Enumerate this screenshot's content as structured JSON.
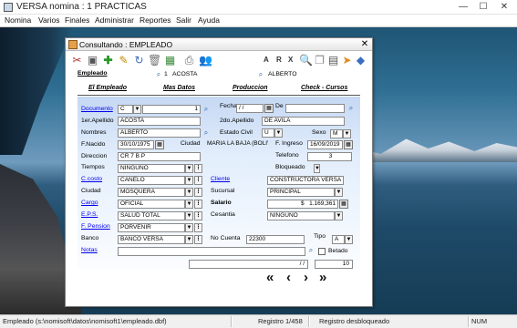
{
  "window": {
    "title": "VERSA nomina : 1 PRACTICAS",
    "minimize": "—",
    "maximize": "☐",
    "close": "✕"
  },
  "menu": [
    "Nomina",
    "Varios",
    "Finales",
    "Administrar",
    "Reportes",
    "Salir",
    "Ayuda"
  ],
  "dialog": {
    "title": "Consultando : EMPLEADO",
    "close": "✕",
    "toolbar_letters": [
      "A",
      "R",
      "X"
    ],
    "empleado_label": "Empleado",
    "empleado_code": "1",
    "empleado_name": "ACOSTA",
    "empleado_first": "ALBERTO",
    "tabs": [
      "El Empleado",
      "Mas Datos",
      "Produccion",
      "Check - Cursos"
    ],
    "fields": {
      "documento": {
        "label": "Documento",
        "type": "C",
        "number": "1"
      },
      "fecha": {
        "label": "Fecha",
        "value": "/ /",
        "de_label": "De"
      },
      "apellido1": {
        "label": "1er.Apellido",
        "value": "ACOSTA"
      },
      "apellido2": {
        "label": "2do.Apellido",
        "value": "DE AVILA"
      },
      "nombres": {
        "label": "Nombres",
        "value": "ALBERTO"
      },
      "estado_civil": {
        "label": "Estado Civil",
        "value": "U"
      },
      "sexo": {
        "label": "Sexo",
        "value": "M"
      },
      "f_nacido": {
        "label": "F.Nacido",
        "value": "30/10/1975"
      },
      "ciudad": {
        "label": "Ciudad",
        "value": "MARIA LA BAJA (BOLIV"
      },
      "f_ingreso": {
        "label": "F. Ingreso",
        "value": "16/09/2019"
      },
      "direccion": {
        "label": "Direccion",
        "value": "CR 7 B P"
      },
      "telefono": {
        "label": "Telefono",
        "value": "3"
      },
      "tiempos": {
        "label": "Tiempos",
        "value": "NINGUNO"
      },
      "bloqueado": {
        "label": "Bloqueado"
      },
      "c_costo": {
        "label": "C.costo",
        "value": "CANELO"
      },
      "cliente": {
        "label": "Cliente",
        "value": "CONSTRUCTORA VERSA"
      },
      "ciudad2": {
        "label": "Ciudad",
        "value": "MOSQUERA"
      },
      "sucursal": {
        "label": "Sucursal",
        "value": "PRINCIPAL"
      },
      "cargo": {
        "label": "Cargo",
        "value": "OFICIAL"
      },
      "salario": {
        "label": "Salario",
        "currency": "$",
        "value": "1.169,361"
      },
      "eps": {
        "label": "E.P.S.",
        "value": "SALUD TOTAL"
      },
      "cesantia": {
        "label": "Cesantia",
        "value": "NINGUNO"
      },
      "f_pension": {
        "label": "F. Pension",
        "value": "PORVENIR"
      },
      "banco": {
        "label": "Banco",
        "value": "BANCO VERSA"
      },
      "no_cuenta": {
        "label": "No Cuenta",
        "value": "22300"
      },
      "tipo": {
        "label": "Tipo",
        "value": "A"
      },
      "notas": {
        "label": "Notas"
      },
      "betado": {
        "label": "Betado"
      }
    },
    "footer": {
      "date": "/ /",
      "number": "10"
    },
    "nav": [
      "«",
      "‹",
      "›",
      "»"
    ]
  },
  "status": {
    "path": "Empleado (s:\\nomisoft\\datos\\nomisoft1\\empleado.dbf)",
    "record": "Registro 1/458",
    "state": "Registro desbloqueado",
    "num": "NUM"
  },
  "colors": {
    "form_gradient_top": "#c5d8f3",
    "link": "#0000ee"
  }
}
